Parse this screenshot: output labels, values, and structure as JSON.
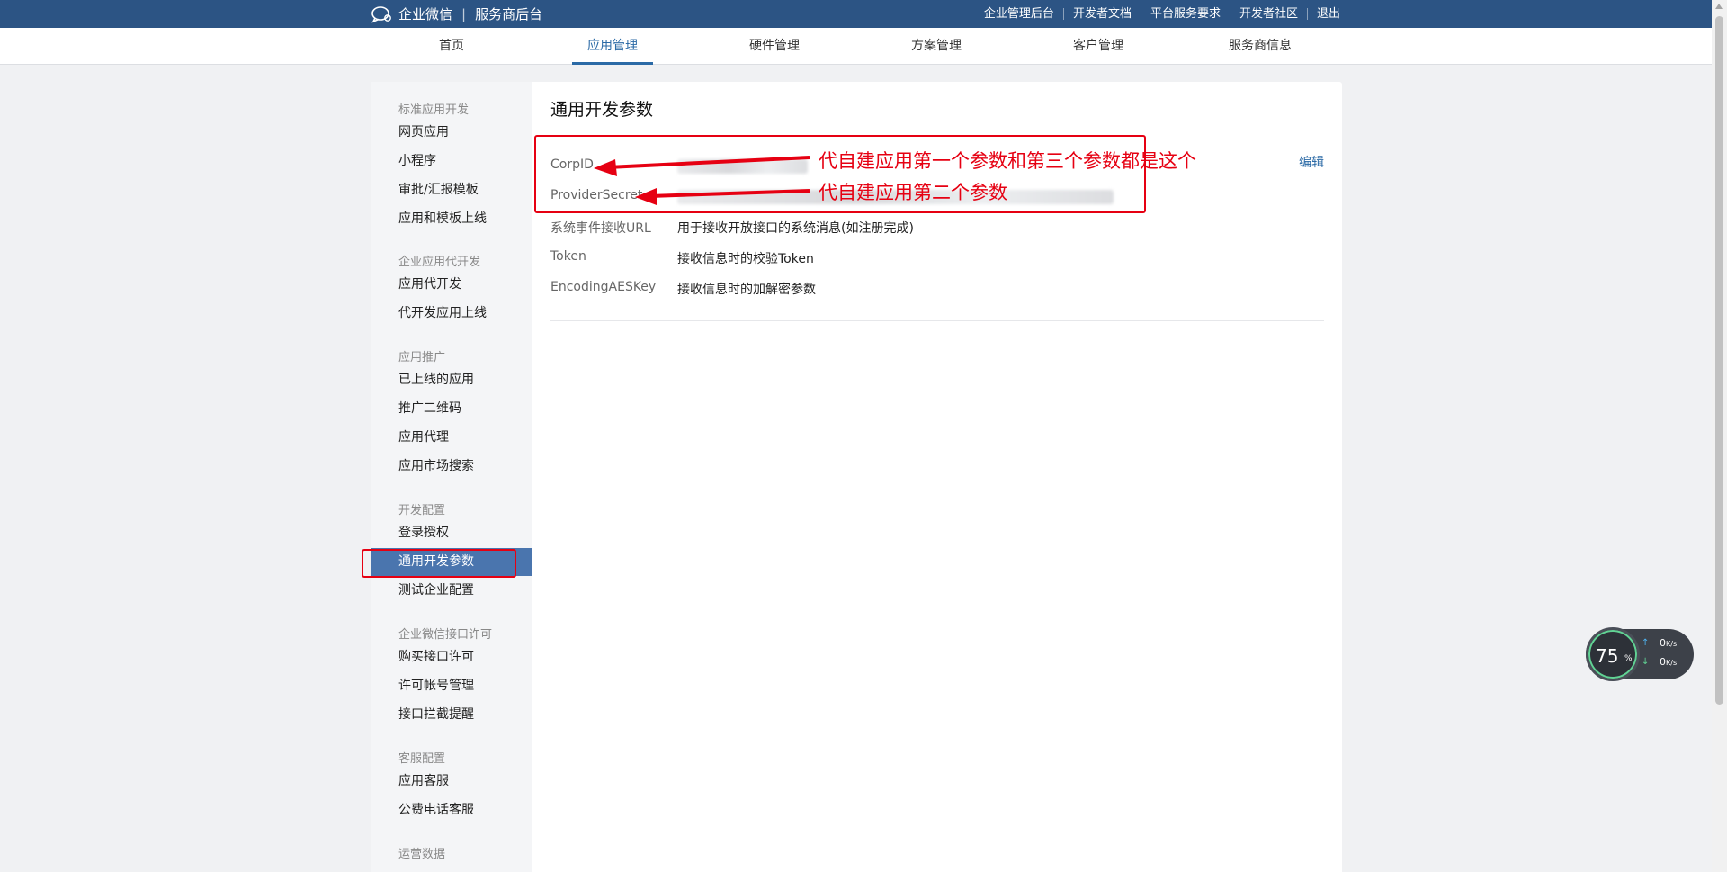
{
  "topbar": {
    "brand": "企业微信",
    "subtitle": "服务商后台",
    "links": [
      "企业管理后台",
      "开发者文档",
      "平台服务要求",
      "开发者社区",
      "退出"
    ]
  },
  "nav": {
    "items": [
      "首页",
      "应用管理",
      "硬件管理",
      "方案管理",
      "客户管理",
      "服务商信息"
    ],
    "active": "应用管理"
  },
  "sidebar": {
    "groups": [
      {
        "title": "标准应用开发",
        "items": [
          "网页应用",
          "小程序",
          "审批/汇报模板",
          "应用和模板上线"
        ]
      },
      {
        "title": "企业应用代开发",
        "items": [
          "应用代开发",
          "代开发应用上线"
        ]
      },
      {
        "title": "应用推广",
        "items": [
          "已上线的应用",
          "推广二维码",
          "应用代理",
          "应用市场搜索"
        ]
      },
      {
        "title": "开发配置",
        "items": [
          "登录授权",
          "通用开发参数",
          "测试企业配置"
        ]
      },
      {
        "title": "企业微信接口许可",
        "items": [
          "购买接口许可",
          "许可帐号管理",
          "接口拦截提醒"
        ]
      },
      {
        "title": "客服配置",
        "items": [
          "应用客服",
          "公费电话客服"
        ]
      },
      {
        "title": "运营数据",
        "items": []
      }
    ],
    "active_item": "通用开发参数"
  },
  "main": {
    "title": "通用开发参数",
    "edit": "编辑",
    "params": [
      {
        "label": "CorpID",
        "value": ""
      },
      {
        "label": "ProviderSecret",
        "value": ""
      },
      {
        "label": "系统事件接收URL",
        "value": "用于接收开放接口的系统消息(如注册完成)"
      },
      {
        "label": "Token",
        "value": "接收信息时的校验Token"
      },
      {
        "label": "EncodingAESKey",
        "value": "接收信息时的加解密参数"
      }
    ]
  },
  "annotations": {
    "note1": "代自建应用第一个参数和第三个参数都是这个",
    "note2": "代自建应用第二个参数",
    "color": "#e60012"
  },
  "net_widget": {
    "percent": "75",
    "percent_sign": "%",
    "up": "0",
    "down": "0",
    "unit": "K/s"
  }
}
